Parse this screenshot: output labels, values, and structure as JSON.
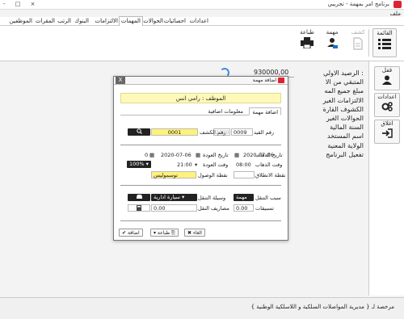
{
  "window": {
    "title": "برنامج امر بمهمة - تجريبي",
    "controls": "- □ ×"
  },
  "file_label": "ملف",
  "menu": {
    "tabs": [
      {
        "label": "الموظفين"
      },
      {
        "label": "المقرات"
      },
      {
        "label": "الرتب"
      },
      {
        "label": "البنوك"
      },
      {
        "label": "الالتزامات"
      },
      {
        "label": "المهمات"
      },
      {
        "label": "الحوالات"
      },
      {
        "label": "احصائيات"
      },
      {
        "label": "اعدادات"
      }
    ]
  },
  "ribbon": {
    "list_label": "القائمة",
    "clear_label": "كشف",
    "task_label": "مهمة",
    "print_label": "طباعة"
  },
  "sidebar": {
    "lock_label": "قفل",
    "settings_label": "اعدادات",
    "close_label": "اغلاق"
  },
  "background": {
    "value": "930000,00",
    "items": [
      "الرصيد الاولي :",
      "المتبقي من الا",
      "مبلغ جميع المه",
      "الالتزامات الغير",
      "الكشوف القارة",
      "الحوالات الغير",
      "السنة المالية",
      "اسم المستخد",
      "الولاية المعنية",
      "تفعيل البرنامج"
    ]
  },
  "statusbar": {
    "text": "مرخصة لـ { مديرية المواصلات السلكية و اللاسلكية الوطنية }"
  },
  "modal": {
    "title": "اضافة مهمة",
    "close": "X",
    "banner": "الموظف : رامي انس",
    "tabs": {
      "add": "اضافة مهمة",
      "extra": "معلومات اضافية"
    },
    "reg_label": "رقم القيد",
    "reg_value": "0009",
    "year_value": "2020",
    "statement_label": "رقم الكشف",
    "statement_value": "0001",
    "depart_date_label": "تاريخ الذهاب",
    "depart_date": "2020-07-06",
    "return_date_label": "تاريخ العودة",
    "return_date": "2020-07-06",
    "days_value": "0",
    "depart_time_label": "وقت الذهاب",
    "depart_time": "08:00",
    "return_time_label": "وقت العودة",
    "return_time": "21:00",
    "percent": "100%",
    "start_point_label": "نقطة الانطلاق",
    "start_point": "",
    "arrival_point_label": "نقطة الوصول",
    "arrival_point": "توسموليس",
    "reason_label": "سبب التنقل",
    "reason": "مهمة ادارية",
    "transport_label": "وسيلة التنقل",
    "transport": "سيارة ادارية",
    "advance_label": "تسبيقات",
    "advance": "0.00",
    "expenses_label": "مصاريف النقل",
    "expenses": "0.00",
    "btn_cancel": "الغاء",
    "btn_print": "طباعة",
    "btn_add": "اضافة"
  },
  "colors": {
    "banner": "#fff9b8",
    "yellow_field": "#fff27a",
    "accent_red": "#dd2233"
  }
}
